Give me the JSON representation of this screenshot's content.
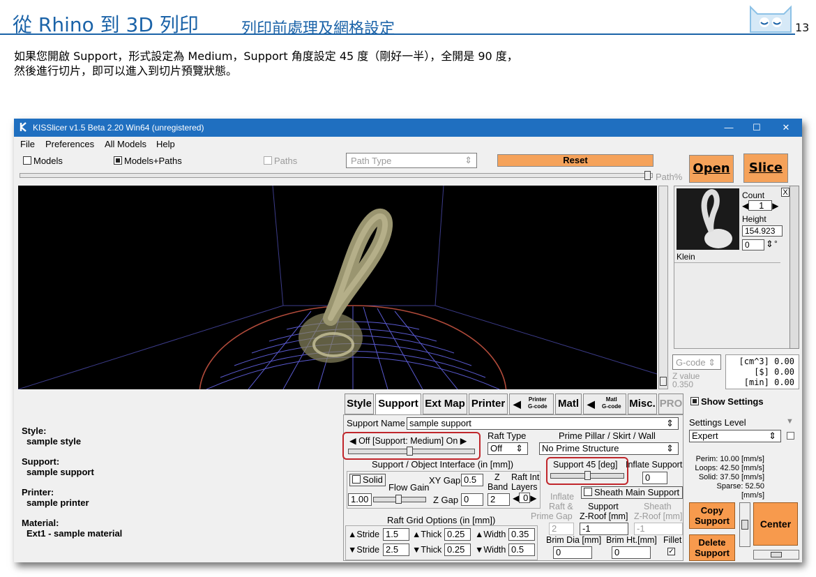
{
  "header": {
    "title": "從 Rhino 到 3D 列印",
    "subtitle": "列印前處理及網格設定",
    "page_number": "13"
  },
  "intro": {
    "line1": "如果您開啟 Support，形式設定為 Medium，Support 角度設定 45 度（剛好一半），全開是 90 度，",
    "line2": "然後進行切片，即可以進入到切片預覽狀態。"
  },
  "window": {
    "title": "KISSlicer v1.5 Beta 2.20 Win64 (unregistered)",
    "minimize": "—",
    "maximize": "☐",
    "close": "✕"
  },
  "menu": [
    "File",
    "Preferences",
    "All Models",
    "Help"
  ],
  "toolbar": {
    "models": "Models",
    "models_paths": "Models+Paths",
    "paths": "Paths",
    "path_type": "Path Type",
    "reset": "Reset",
    "path_pct": "Path%"
  },
  "actions": {
    "open": "Open",
    "slice": "Slice"
  },
  "model_panel": {
    "count_label": "Count",
    "count_value": "1",
    "height_label": "Height",
    "height_value": "154.923",
    "rotation_value": "0",
    "degree": "°",
    "close_x": "X",
    "model_name": "Klein"
  },
  "gcode": {
    "select": "G-code",
    "z_label": "Z value",
    "z_value": "0.350",
    "stat1": "[cm^3] 0.00",
    "stat2": "[$] 0.00",
    "stat3": "[min] 0.00"
  },
  "summary": [
    {
      "label": "Style:",
      "value": "sample style"
    },
    {
      "label": "Support:",
      "value": "sample support"
    },
    {
      "label": "Printer:",
      "value": "sample printer"
    },
    {
      "label": "Material:",
      "value": "Ext1 - sample material"
    }
  ],
  "tabs": {
    "style": "Style",
    "support": "Support",
    "extmap": "Ext Map",
    "printer": "Printer",
    "printer_gcode_top": "Printer",
    "printer_gcode_bottom": "G-code",
    "matl": "Matl",
    "matl_gcode_top": "Matl",
    "matl_gcode_bottom": "G-code",
    "misc": "Misc.",
    "pro": "PRO"
  },
  "support": {
    "name_label": "Support Name",
    "name_value": "sample support",
    "off_on": "◀ Off [Support: Medium] On ▶",
    "raft_type_label": "Raft Type",
    "raft_type_value": "Off",
    "prime_label": "Prime Pillar / Skirt /  Wall",
    "prime_value": "No Prime Structure",
    "interface_label": "Support / Object Interface (in [mm])",
    "solid": "Solid",
    "xy_gap_label": "XY Gap",
    "xy_gap_value": "0.5",
    "z_band_top": "Z",
    "z_band_bottom": "Band",
    "raft_int_top": "Raft Int",
    "raft_int_bottom": "Layers",
    "flow_gain": "Flow Gain",
    "flow_value": "1.00",
    "z_gap_label": "Z Gap",
    "z_gap_value": "0",
    "z_band_value": "2",
    "raft_layers_value": "0",
    "angle_label": "Support 45 [deg]",
    "angle_fraction": 0.5,
    "inflate_support_label": "Inflate Support",
    "inflate_support_value": "0",
    "sheath_main": "Sheath Main Support",
    "inflate_raft_1": "Inflate",
    "inflate_raft_2": "Raft &",
    "inflate_raft_3": "Prime Gap",
    "inflate_raft_value": "2",
    "zroof_1": "Support",
    "zroof_2": "Z-Roof [mm]",
    "zroof_value": "-1",
    "sheath_zroof_1": "Sheath",
    "sheath_zroof_2": "Z-Roof [mm]",
    "sheath_zroof_value": "-1",
    "raft_grid_label": "Raft Grid Options (in [mm])",
    "stride_up_label": "▲Stride",
    "stride_up_value": "1.5",
    "thick_up_label": "▲Thick",
    "thick_up_value": "0.25",
    "width_up_label": "▲Width",
    "width_up_value": "0.35",
    "stride_dn_label": "▼Stride",
    "stride_dn_value": "2.5",
    "thick_dn_label": "▼Thick",
    "thick_dn_value": "0.25",
    "width_dn_label": "▼Width",
    "width_dn_value": "0.5",
    "brim_dia_label": "Brim Dia [mm]",
    "brim_dia_value": "0",
    "brim_ht_label": "Brim Ht.[mm]",
    "brim_ht_value": "0",
    "fillet_label": "Fillet"
  },
  "settings": {
    "show_settings": "Show Settings",
    "level_label": "Settings Level",
    "level_value": "Expert",
    "perim": "Perim:  10.00 [mm/s]",
    "loops": "Loops:  42.50 [mm/s]",
    "solid": "Solid:  37.50 [mm/s]",
    "sparse": "Sparse: 52.50 [mm/s]",
    "copy_1": "Copy",
    "copy_2": "Support",
    "delete_1": "Delete",
    "delete_2": "Support",
    "center": "Center"
  },
  "colors": {
    "accent": "#1b63a8",
    "titlebar": "#1f6fc0",
    "orange": "#f79a4d",
    "highlight": "#c0262b"
  }
}
